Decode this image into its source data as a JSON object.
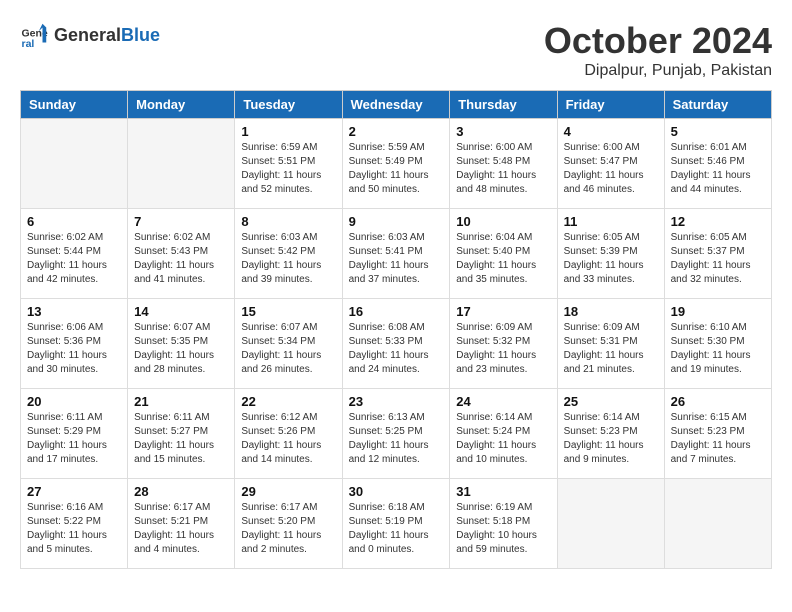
{
  "header": {
    "logo_general": "General",
    "logo_blue": "Blue",
    "month_title": "October 2024",
    "location": "Dipalpur, Punjab, Pakistan"
  },
  "weekdays": [
    "Sunday",
    "Monday",
    "Tuesday",
    "Wednesday",
    "Thursday",
    "Friday",
    "Saturday"
  ],
  "weeks": [
    [
      {
        "day": "",
        "empty": true
      },
      {
        "day": "",
        "empty": true
      },
      {
        "day": "1",
        "sunrise": "6:59 AM",
        "sunset": "5:51 PM",
        "daylight": "11 hours and 52 minutes."
      },
      {
        "day": "2",
        "sunrise": "5:59 AM",
        "sunset": "5:49 PM",
        "daylight": "11 hours and 50 minutes."
      },
      {
        "day": "3",
        "sunrise": "6:00 AM",
        "sunset": "5:48 PM",
        "daylight": "11 hours and 48 minutes."
      },
      {
        "day": "4",
        "sunrise": "6:00 AM",
        "sunset": "5:47 PM",
        "daylight": "11 hours and 46 minutes."
      },
      {
        "day": "5",
        "sunrise": "6:01 AM",
        "sunset": "5:46 PM",
        "daylight": "11 hours and 44 minutes."
      }
    ],
    [
      {
        "day": "6",
        "sunrise": "6:02 AM",
        "sunset": "5:44 PM",
        "daylight": "11 hours and 42 minutes."
      },
      {
        "day": "7",
        "sunrise": "6:02 AM",
        "sunset": "5:43 PM",
        "daylight": "11 hours and 41 minutes."
      },
      {
        "day": "8",
        "sunrise": "6:03 AM",
        "sunset": "5:42 PM",
        "daylight": "11 hours and 39 minutes."
      },
      {
        "day": "9",
        "sunrise": "6:03 AM",
        "sunset": "5:41 PM",
        "daylight": "11 hours and 37 minutes."
      },
      {
        "day": "10",
        "sunrise": "6:04 AM",
        "sunset": "5:40 PM",
        "daylight": "11 hours and 35 minutes."
      },
      {
        "day": "11",
        "sunrise": "6:05 AM",
        "sunset": "5:39 PM",
        "daylight": "11 hours and 33 minutes."
      },
      {
        "day": "12",
        "sunrise": "6:05 AM",
        "sunset": "5:37 PM",
        "daylight": "11 hours and 32 minutes."
      }
    ],
    [
      {
        "day": "13",
        "sunrise": "6:06 AM",
        "sunset": "5:36 PM",
        "daylight": "11 hours and 30 minutes."
      },
      {
        "day": "14",
        "sunrise": "6:07 AM",
        "sunset": "5:35 PM",
        "daylight": "11 hours and 28 minutes."
      },
      {
        "day": "15",
        "sunrise": "6:07 AM",
        "sunset": "5:34 PM",
        "daylight": "11 hours and 26 minutes."
      },
      {
        "day": "16",
        "sunrise": "6:08 AM",
        "sunset": "5:33 PM",
        "daylight": "11 hours and 24 minutes."
      },
      {
        "day": "17",
        "sunrise": "6:09 AM",
        "sunset": "5:32 PM",
        "daylight": "11 hours and 23 minutes."
      },
      {
        "day": "18",
        "sunrise": "6:09 AM",
        "sunset": "5:31 PM",
        "daylight": "11 hours and 21 minutes."
      },
      {
        "day": "19",
        "sunrise": "6:10 AM",
        "sunset": "5:30 PM",
        "daylight": "11 hours and 19 minutes."
      }
    ],
    [
      {
        "day": "20",
        "sunrise": "6:11 AM",
        "sunset": "5:29 PM",
        "daylight": "11 hours and 17 minutes."
      },
      {
        "day": "21",
        "sunrise": "6:11 AM",
        "sunset": "5:27 PM",
        "daylight": "11 hours and 15 minutes."
      },
      {
        "day": "22",
        "sunrise": "6:12 AM",
        "sunset": "5:26 PM",
        "daylight": "11 hours and 14 minutes."
      },
      {
        "day": "23",
        "sunrise": "6:13 AM",
        "sunset": "5:25 PM",
        "daylight": "11 hours and 12 minutes."
      },
      {
        "day": "24",
        "sunrise": "6:14 AM",
        "sunset": "5:24 PM",
        "daylight": "11 hours and 10 minutes."
      },
      {
        "day": "25",
        "sunrise": "6:14 AM",
        "sunset": "5:23 PM",
        "daylight": "11 hours and 9 minutes."
      },
      {
        "day": "26",
        "sunrise": "6:15 AM",
        "sunset": "5:23 PM",
        "daylight": "11 hours and 7 minutes."
      }
    ],
    [
      {
        "day": "27",
        "sunrise": "6:16 AM",
        "sunset": "5:22 PM",
        "daylight": "11 hours and 5 minutes."
      },
      {
        "day": "28",
        "sunrise": "6:17 AM",
        "sunset": "5:21 PM",
        "daylight": "11 hours and 4 minutes."
      },
      {
        "day": "29",
        "sunrise": "6:17 AM",
        "sunset": "5:20 PM",
        "daylight": "11 hours and 2 minutes."
      },
      {
        "day": "30",
        "sunrise": "6:18 AM",
        "sunset": "5:19 PM",
        "daylight": "11 hours and 0 minutes."
      },
      {
        "day": "31",
        "sunrise": "6:19 AM",
        "sunset": "5:18 PM",
        "daylight": "10 hours and 59 minutes."
      },
      {
        "day": "",
        "empty": true,
        "shaded": true
      },
      {
        "day": "",
        "empty": true,
        "shaded": true
      }
    ]
  ]
}
